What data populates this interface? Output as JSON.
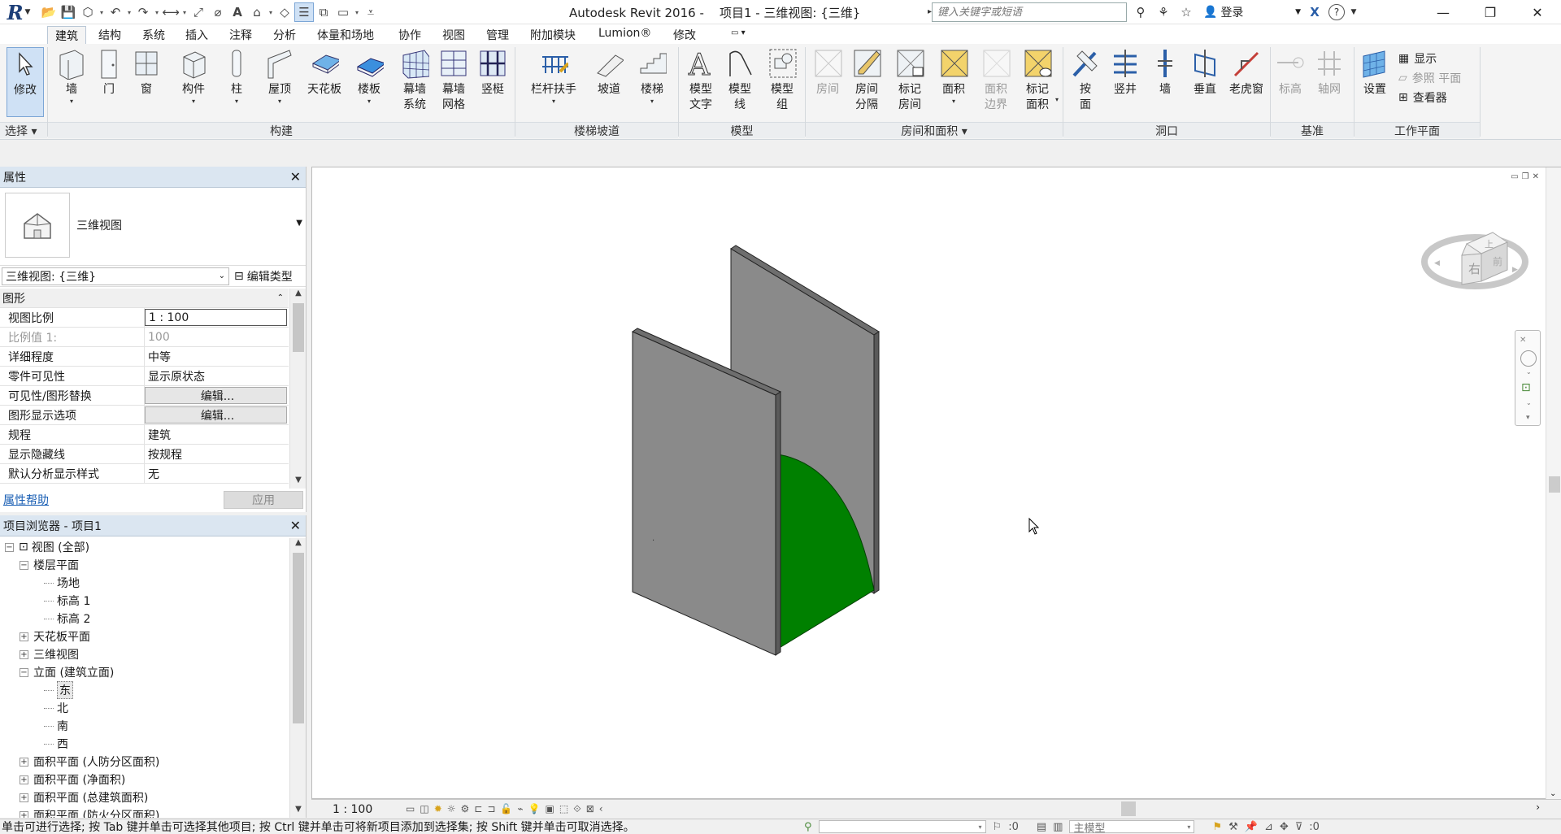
{
  "app": {
    "title": "Autodesk Revit 2016 -    项目1 - 三维视图: {三维}",
    "search_placeholder": "键入关键字或短语",
    "login_label": "登录"
  },
  "tabs": [
    "建筑",
    "结构",
    "系统",
    "插入",
    "注释",
    "分析",
    "体量和场地",
    "协作",
    "视图",
    "管理",
    "附加模块",
    "Lumion®",
    "修改"
  ],
  "ribbon": {
    "select": {
      "modify": "修改",
      "select_menu": "选择"
    },
    "build": {
      "panel": "构建",
      "wall": "墙",
      "door": "门",
      "window": "窗",
      "component": "构件",
      "column": "柱",
      "roof": "屋顶",
      "ceiling": "天花板",
      "floor": "楼板",
      "curtain_system": [
        "幕墙",
        "系统"
      ],
      "curtain_grid": [
        "幕墙",
        "网格"
      ],
      "mullion": "竖梃"
    },
    "stairs": {
      "panel": "楼梯坡道",
      "railing": "栏杆扶手",
      "ramp": "坡道",
      "stair": "楼梯"
    },
    "model": {
      "panel": "模型",
      "model_text": [
        "模型",
        "文字"
      ],
      "model_line": [
        "模型",
        "线"
      ],
      "model_group": [
        "模型",
        "组"
      ]
    },
    "room": {
      "panel": "房间和面积",
      "room": "房间",
      "room_separator": [
        "房间",
        "分隔"
      ],
      "tag_room": [
        "标记",
        "房间"
      ],
      "area": "面积",
      "area_boundary": [
        "面积",
        "边界"
      ],
      "tag_area": [
        "标记",
        "面积"
      ]
    },
    "opening": {
      "panel": "洞口",
      "by_face": [
        "按",
        "面"
      ],
      "shaft": "竖井",
      "wall": "墙",
      "vertical": "垂直",
      "dormer": "老虎窗"
    },
    "datum": {
      "panel": "基准",
      "level": "标高",
      "grid": "轴网"
    },
    "workplane": {
      "panel": "工作平面",
      "set": "设置",
      "show": "显示",
      "ref_plane": "参照 平面",
      "viewer": "查看器"
    }
  },
  "properties": {
    "title": "属性",
    "type_name": "三维视图",
    "instance_selector": "三维视图: {三维}",
    "edit_type": "编辑类型",
    "group": "图形",
    "rows": [
      {
        "k": "视图比例",
        "v": "1 : 100",
        "style": "boxed"
      },
      {
        "k": "比例值 1:",
        "v": "100",
        "style": "dim"
      },
      {
        "k": "详细程度",
        "v": "中等",
        "style": ""
      },
      {
        "k": "零件可见性",
        "v": "显示原状态",
        "style": ""
      },
      {
        "k": "可见性/图形替换",
        "v": "编辑...",
        "style": "btn"
      },
      {
        "k": "图形显示选项",
        "v": "编辑...",
        "style": "btn"
      },
      {
        "k": "规程",
        "v": "建筑",
        "style": ""
      },
      {
        "k": "显示隐藏线",
        "v": "按规程",
        "style": ""
      },
      {
        "k": "默认分析显示样式",
        "v": "无",
        "style": ""
      }
    ],
    "help_link": "属性帮助",
    "apply": "应用"
  },
  "browser": {
    "title": "项目浏览器 - 项目1",
    "items": [
      {
        "label": "视图 (全部)",
        "level": 0,
        "tog": "−",
        "icon": true
      },
      {
        "label": "楼层平面",
        "level": 1,
        "tog": "−"
      },
      {
        "label": "场地",
        "level": 2,
        "tog": ""
      },
      {
        "label": "标高 1",
        "level": 2,
        "tog": ""
      },
      {
        "label": "标高 2",
        "level": 2,
        "tog": ""
      },
      {
        "label": "天花板平面",
        "level": 1,
        "tog": "+"
      },
      {
        "label": "三维视图",
        "level": 1,
        "tog": "+"
      },
      {
        "label": "立面 (建筑立面)",
        "level": 1,
        "tog": "−"
      },
      {
        "label": "东",
        "level": 2,
        "tog": "",
        "selected": true
      },
      {
        "label": "北",
        "level": 2,
        "tog": ""
      },
      {
        "label": "南",
        "level": 2,
        "tog": ""
      },
      {
        "label": "西",
        "level": 2,
        "tog": ""
      },
      {
        "label": "面积平面 (人防分区面积)",
        "level": 1,
        "tog": "+"
      },
      {
        "label": "面积平面 (净面积)",
        "level": 1,
        "tog": "+"
      },
      {
        "label": "面积平面 (总建筑面积)",
        "level": 1,
        "tog": "+"
      },
      {
        "label": "面积平面 (防火分区面积)",
        "level": 1,
        "tog": "+"
      }
    ]
  },
  "viewcube": {
    "face_right": "右",
    "face_top": "上",
    "face_front": "前"
  },
  "view_bar": {
    "scale": "1 : 100"
  },
  "status": {
    "message": "单击可进行选择; 按 Tab 键并单击可选择其他项目; 按 Ctrl 键并单击可将新项目添加到选择集; 按 Shift 键并单击可取消选择。",
    "zero": ":0",
    "model": "主模型"
  },
  "colors": {
    "accent": "#1d3f78",
    "wall": "#8a8a8a",
    "green_face": "#008000"
  }
}
